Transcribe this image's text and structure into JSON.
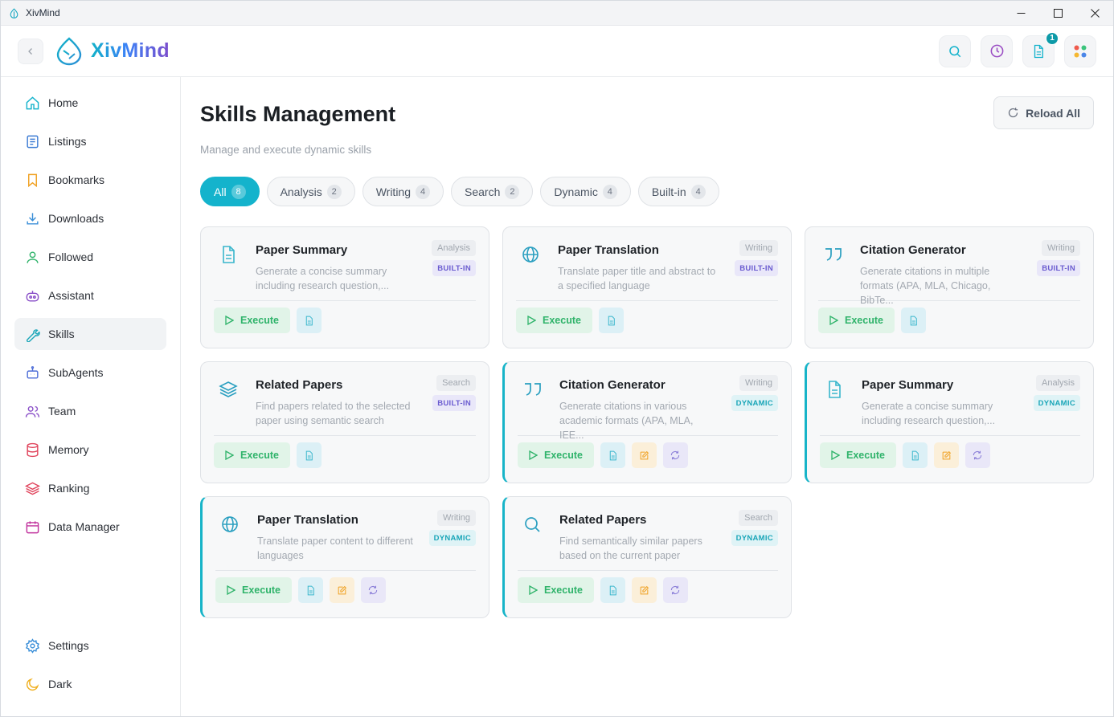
{
  "window": {
    "title": "XivMind"
  },
  "header": {
    "logo_text": "XivMind",
    "docs_badge": "1"
  },
  "sidebar": {
    "items": [
      {
        "label": "Home",
        "icon": "home-icon",
        "active": false
      },
      {
        "label": "Listings",
        "icon": "list-icon",
        "active": false
      },
      {
        "label": "Bookmarks",
        "icon": "bookmark-icon",
        "active": false
      },
      {
        "label": "Downloads",
        "icon": "download-icon",
        "active": false
      },
      {
        "label": "Followed",
        "icon": "user-icon",
        "active": false
      },
      {
        "label": "Assistant",
        "icon": "robot-icon",
        "active": false
      },
      {
        "label": "Skills",
        "icon": "wrench-icon",
        "active": true
      },
      {
        "label": "SubAgents",
        "icon": "bot-icon",
        "active": false
      },
      {
        "label": "Team",
        "icon": "users-icon",
        "active": false
      },
      {
        "label": "Memory",
        "icon": "database-icon",
        "active": false
      },
      {
        "label": "Ranking",
        "icon": "layers-icon",
        "active": false
      },
      {
        "label": "Data Manager",
        "icon": "calendar-icon",
        "active": false
      }
    ],
    "bottom": [
      {
        "label": "Settings",
        "icon": "gear-icon"
      },
      {
        "label": "Dark",
        "icon": "moon-icon"
      }
    ]
  },
  "main": {
    "title": "Skills Management",
    "subtitle": "Manage and execute dynamic skills",
    "reload_label": "Reload All",
    "filters": [
      {
        "label": "All",
        "count": "8",
        "active": true
      },
      {
        "label": "Analysis",
        "count": "2",
        "active": false
      },
      {
        "label": "Writing",
        "count": "4",
        "active": false
      },
      {
        "label": "Search",
        "count": "2",
        "active": false
      },
      {
        "label": "Dynamic",
        "count": "4",
        "active": false
      },
      {
        "label": "Built-in",
        "count": "4",
        "active": false
      }
    ],
    "execute_label": "Execute",
    "cards": [
      {
        "title": "Paper Summary",
        "desc": "Generate a concise summary including research question,...",
        "category": "Analysis",
        "type": "BUILT-IN",
        "icon": "document-icon"
      },
      {
        "title": "Paper Translation",
        "desc": "Translate paper title and abstract to a specified language",
        "category": "Writing",
        "type": "BUILT-IN",
        "icon": "globe-icon"
      },
      {
        "title": "Citation Generator",
        "desc": "Generate citations in multiple formats (APA, MLA, Chicago, BibTe...",
        "category": "Writing",
        "type": "BUILT-IN",
        "icon": "quote-icon"
      },
      {
        "title": "Related Papers",
        "desc": "Find papers related to the selected paper using semantic search",
        "category": "Search",
        "type": "BUILT-IN",
        "icon": "layers-icon"
      },
      {
        "title": "Citation Generator",
        "desc": "Generate citations in various academic formats (APA, MLA, IEE...",
        "category": "Writing",
        "type": "DYNAMIC",
        "icon": "quote-icon"
      },
      {
        "title": "Paper Summary",
        "desc": "Generate a concise summary including research question,...",
        "category": "Analysis",
        "type": "DYNAMIC",
        "icon": "document-icon"
      },
      {
        "title": "Paper Translation",
        "desc": "Translate paper content to different languages",
        "category": "Writing",
        "type": "DYNAMIC",
        "icon": "globe-icon"
      },
      {
        "title": "Related Papers",
        "desc": "Find semantically similar papers based on the current paper",
        "category": "Search",
        "type": "DYNAMIC",
        "icon": "search-icon"
      }
    ]
  },
  "colors": {
    "accent": "#14b3cc",
    "execute_green": "#2fb36a",
    "builtin_purple": "#6a5bd0",
    "dynamic_teal": "#1aa6b8"
  }
}
